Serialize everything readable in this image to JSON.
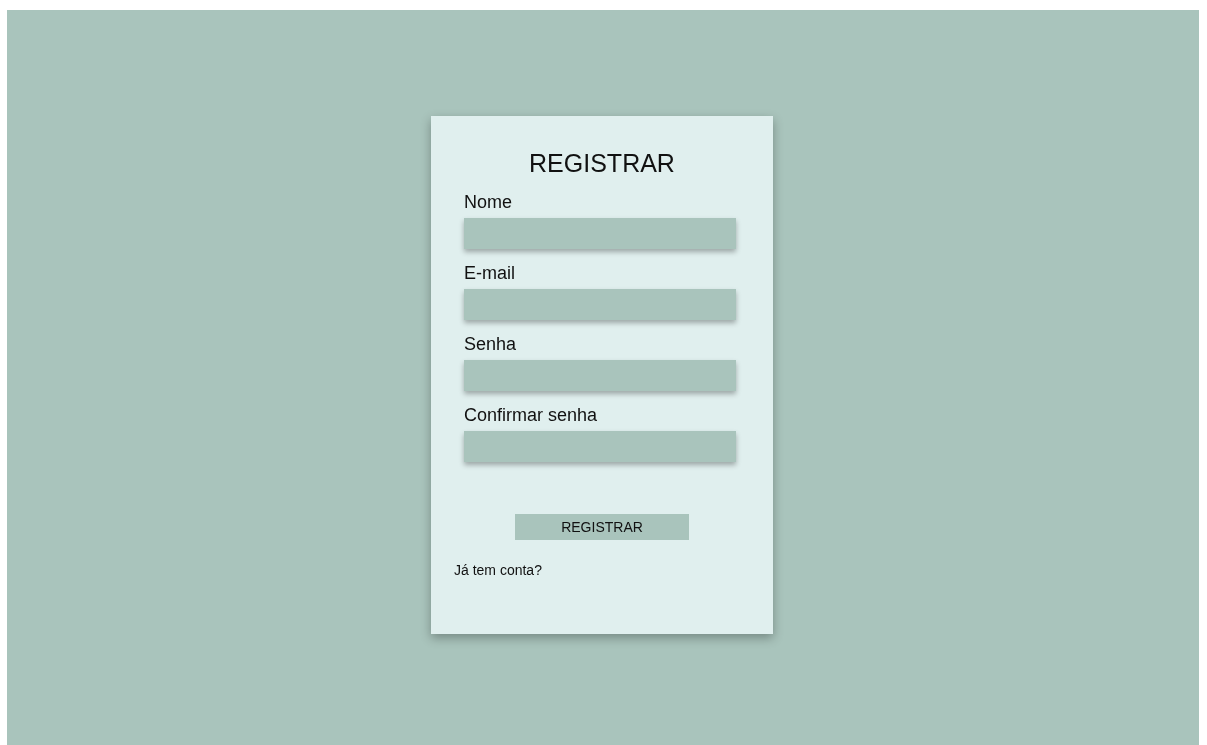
{
  "title": "REGISTRAR",
  "fields": [
    {
      "label": "Nome"
    },
    {
      "label": "E-mail"
    },
    {
      "label": "Senha"
    },
    {
      "label": "Confirmar senha"
    }
  ],
  "button": "REGISTRAR",
  "link": "Já tem conta?"
}
